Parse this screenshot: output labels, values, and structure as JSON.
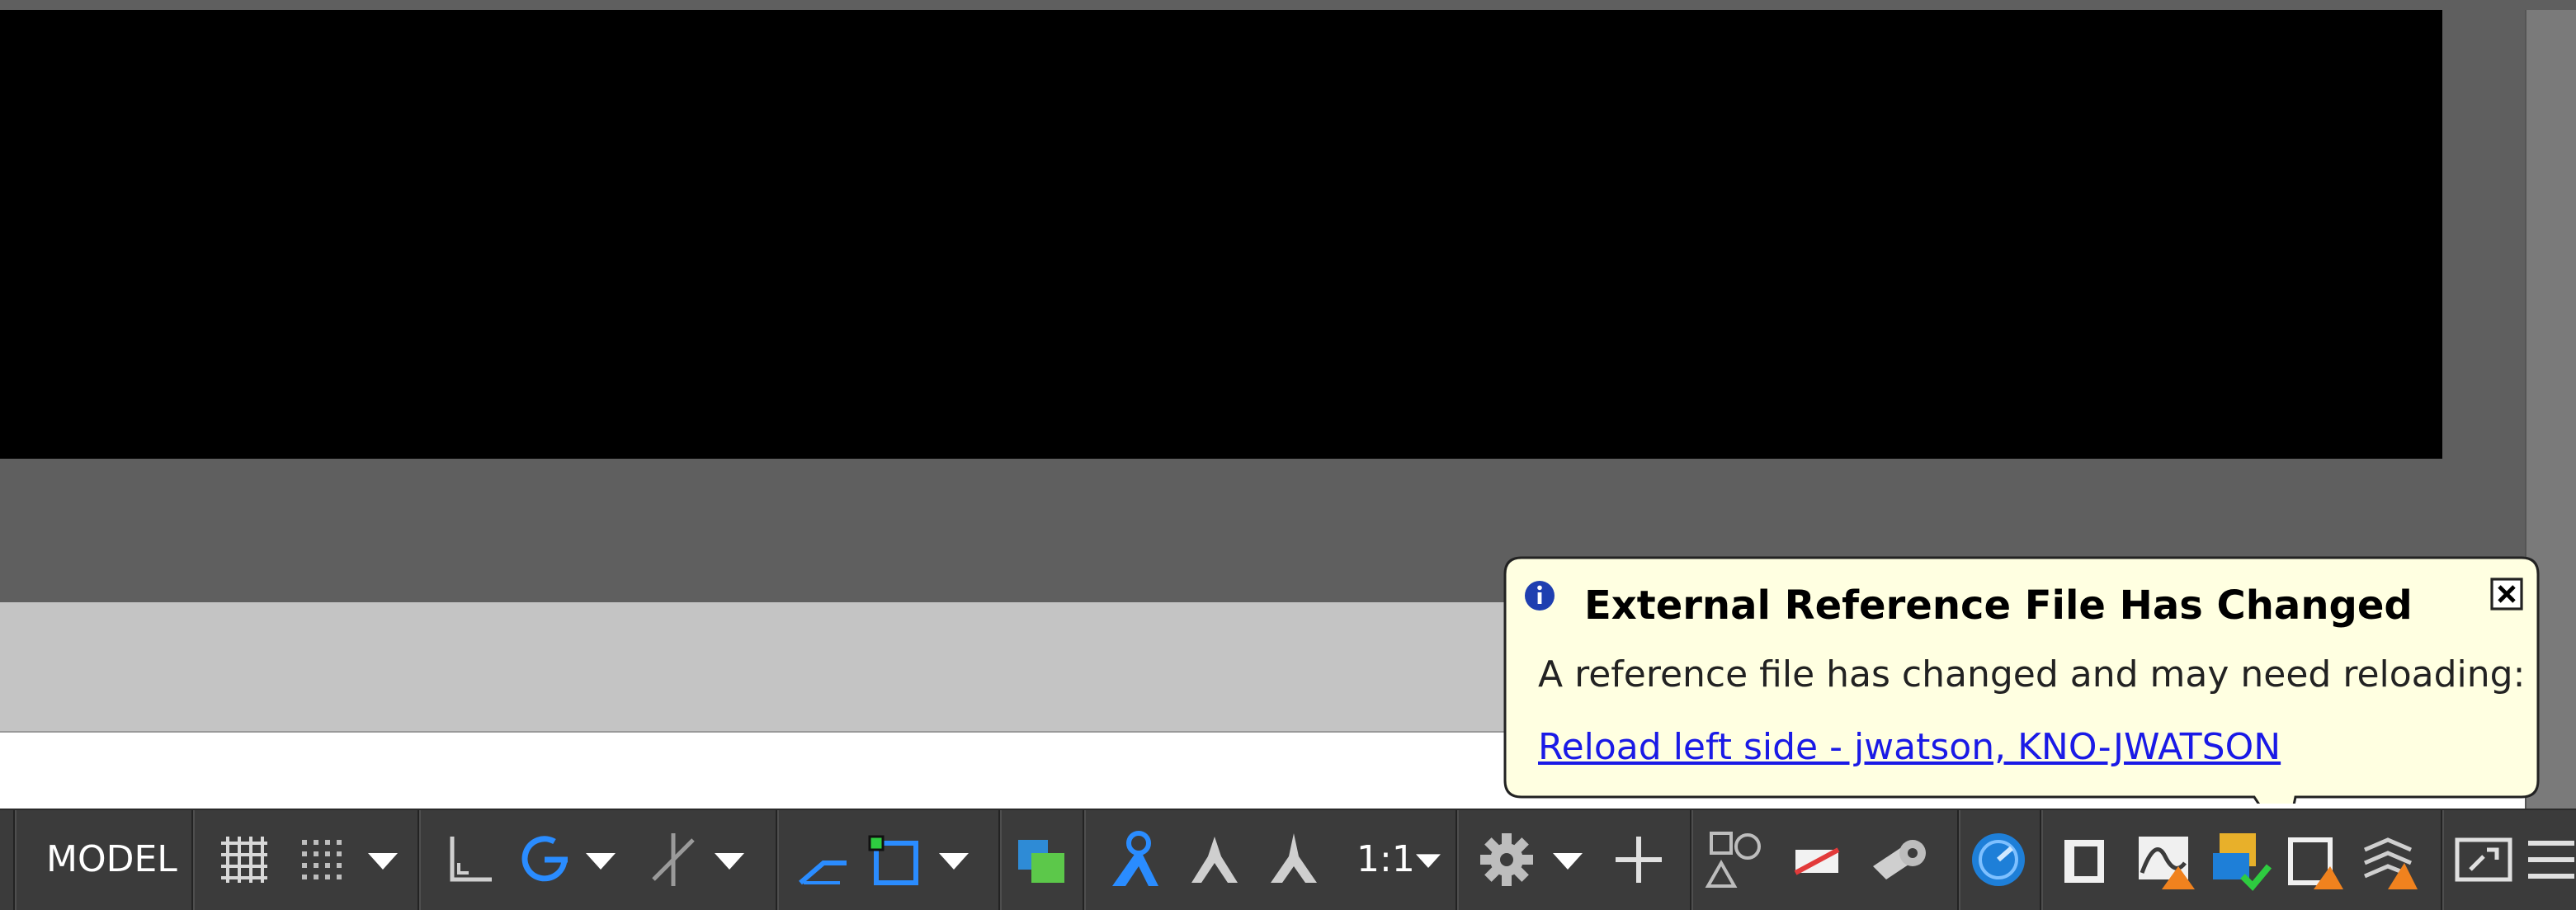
{
  "statusbar": {
    "model_label": "MODEL",
    "annotation_scale": "1:1",
    "icons": {
      "grid": "grid-icon",
      "snap": "snap-grid-icon",
      "ortho": "ortho-icon",
      "polar": "polar-tracking-icon",
      "isodraft": "isodraft-icon",
      "osnap_track": "object-snap-tracking-icon",
      "osnap": "object-snap-icon",
      "transparency": "transparency-icon",
      "anno_visibility": "annotation-visibility-icon",
      "auto_scale": "auto-scale-icon",
      "annotation": "annotation-icon",
      "workspace": "workspace-gear-icon",
      "plus": "plus-icon",
      "isolate": "isolate-objects-icon",
      "hardware": "hardware-acceleration-icon",
      "clean_screen": "clean-screen-icon",
      "customize": "customize-menu-icon"
    },
    "colors": {
      "accent": "#1e90ff",
      "warning": "#f0821e",
      "bg": "#3b3b3b"
    }
  },
  "balloon": {
    "title": "External Reference File Has Changed",
    "message": "A reference file has changed and may need reloading:",
    "link": "Reload left side - jwatson, KNO-JWATSON ",
    "bg_color": "#ffffe1"
  }
}
